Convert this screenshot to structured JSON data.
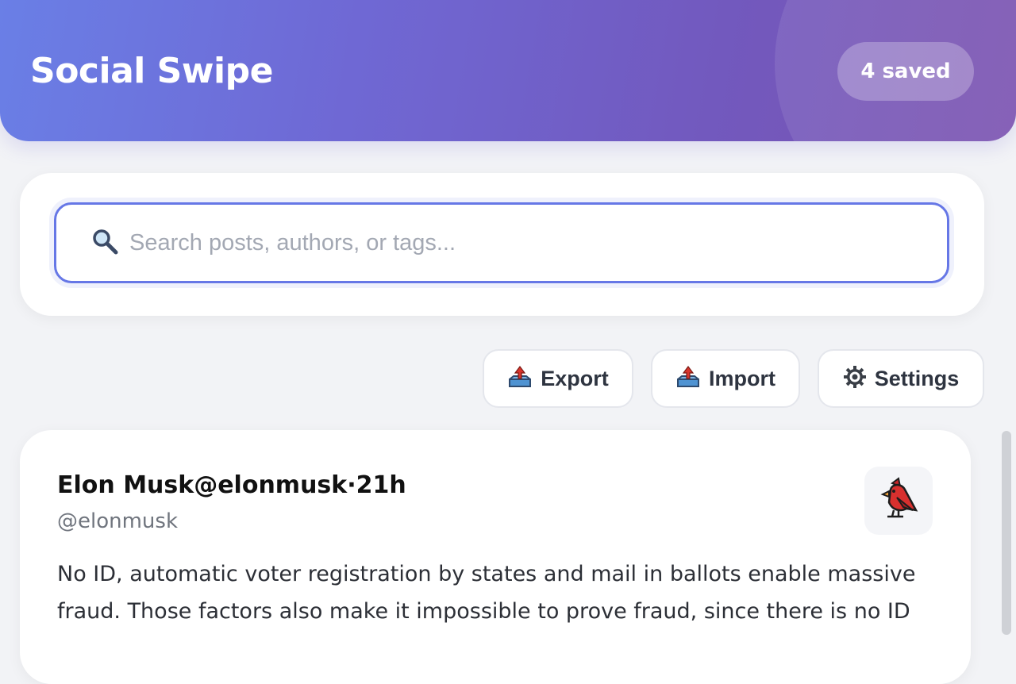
{
  "header": {
    "title": "Social Swipe",
    "saved_badge": "4 saved",
    "colors": {
      "gradient_start": "#6a7fe6",
      "gradient_end": "#7a52b0"
    }
  },
  "search": {
    "placeholder": "Search posts, authors, or tags...",
    "value": "",
    "icon": "magnifier-icon",
    "border_color": "#6677e6"
  },
  "toolbar": {
    "export_label": "Export",
    "export_icon": "📤",
    "import_label": "Import",
    "import_icon": "📥",
    "settings_label": "Settings",
    "settings_icon": "⚙"
  },
  "post": {
    "header": "Elon Musk@elonmusk·21h",
    "handle": "@elonmusk",
    "avatar_icon": "cardinal-bird-icon",
    "body": "No ID, automatic voter registration by states and mail in ballots enable massive fraud. Those factors also make it impossible to prove fraud, since there is no ID"
  }
}
